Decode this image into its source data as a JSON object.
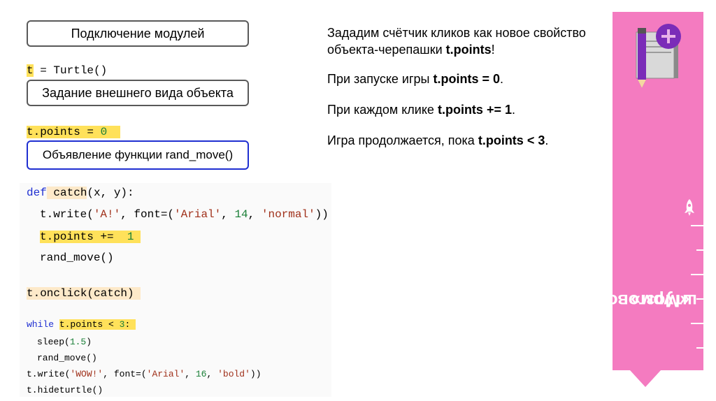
{
  "boxes": {
    "modules": "Подключение модулей",
    "appearance": "Задание внешнего вида объекта",
    "rand_func": "Объявление функции rand_move()"
  },
  "code": {
    "line_turtle_var": "t",
    "line_turtle_rest": " = Turtle()",
    "points_init_a": "t.points = ",
    "points_init_b": "0",
    "def_kw": "def",
    "def_name": " catch",
    "def_rest": "(x, y):",
    "write_a": "t.write(",
    "write_str1": "'A!'",
    "write_b": ", font=(",
    "write_str2": "'Arial'",
    "write_c": ", ",
    "write_num": "14",
    "write_d": ", ",
    "write_str3": "'normal'",
    "write_e": "))",
    "points_inc_a": "t.points += ",
    "points_inc_b": "1",
    "rand_move": "rand_move()",
    "onclick": "t.onclick(catch)",
    "while_kw": "while",
    "while_cond_a": "t.points < ",
    "while_cond_b": "3",
    "while_cond_c": ":",
    "sleep_a": "sleep(",
    "sleep_b": "1.5",
    "sleep_c": ")",
    "rand_move2": "rand_move()",
    "wow_a": "t.write(",
    "wow_str1": "'WOW!'",
    "wow_b": ", font=(",
    "wow_str2": "'Arial'",
    "wow_c": ", ",
    "wow_num": "16",
    "wow_d": ", ",
    "wow_str3": "'bold'",
    "wow_e": "))",
    "hideturtle": "t.hideturtle()"
  },
  "explanation": {
    "p1_a": "Зададим счётчик кликов как новое свойство",
    "p1_b": "объекта-черепашки ",
    "p1_bold": "t.points",
    "p1_c": "!",
    "p2_a": "При запуске игры ",
    "p2_bold": "t.points = 0",
    "p2_c": ".",
    "p3_a": "При каждом клике ",
    "p3_bold": "t.points += 1",
    "p3_c": ".",
    "p4_a": "Игра продолжается, пока ",
    "p4_bold": "t.points < 3",
    "p4_c": "."
  },
  "sidebar": {
    "label_line1": "«Мозговой",
    "label_line2": "штурм»",
    "color": "#f47bc0",
    "icons": [
      "notebook-pencil-plus-icon",
      "rocket-icon"
    ]
  }
}
